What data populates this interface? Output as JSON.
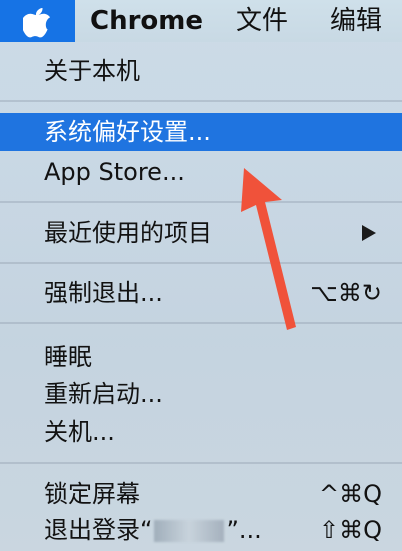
{
  "menubar": {
    "apple_icon": "apple-logo-icon",
    "chrome_label": "Chrome",
    "file_label": "文件",
    "edit_label": "编辑",
    "accent_color": "#1673e5"
  },
  "menu": {
    "about": "关于本机",
    "system_prefs": "系统偏好设置...",
    "app_store": "App Store...",
    "recent_items": "最近使用的项目",
    "force_quit": "强制退出...",
    "force_quit_shortcut": "⌥⌘↻",
    "sleep": "睡眠",
    "restart": "重新启动...",
    "shutdown": "关机...",
    "lock_screen": "锁定屏幕",
    "lock_shortcut": "^⌘Q",
    "logout_prefix": "退出登录“",
    "logout_suffix": "”...",
    "logout_shortcut": "⇧⌘Q",
    "submenu_icon": "submenu-arrow-icon"
  },
  "annotation": {
    "arrow_color": "#f0523a",
    "arrow_icon": "pointer-arrow-icon"
  }
}
